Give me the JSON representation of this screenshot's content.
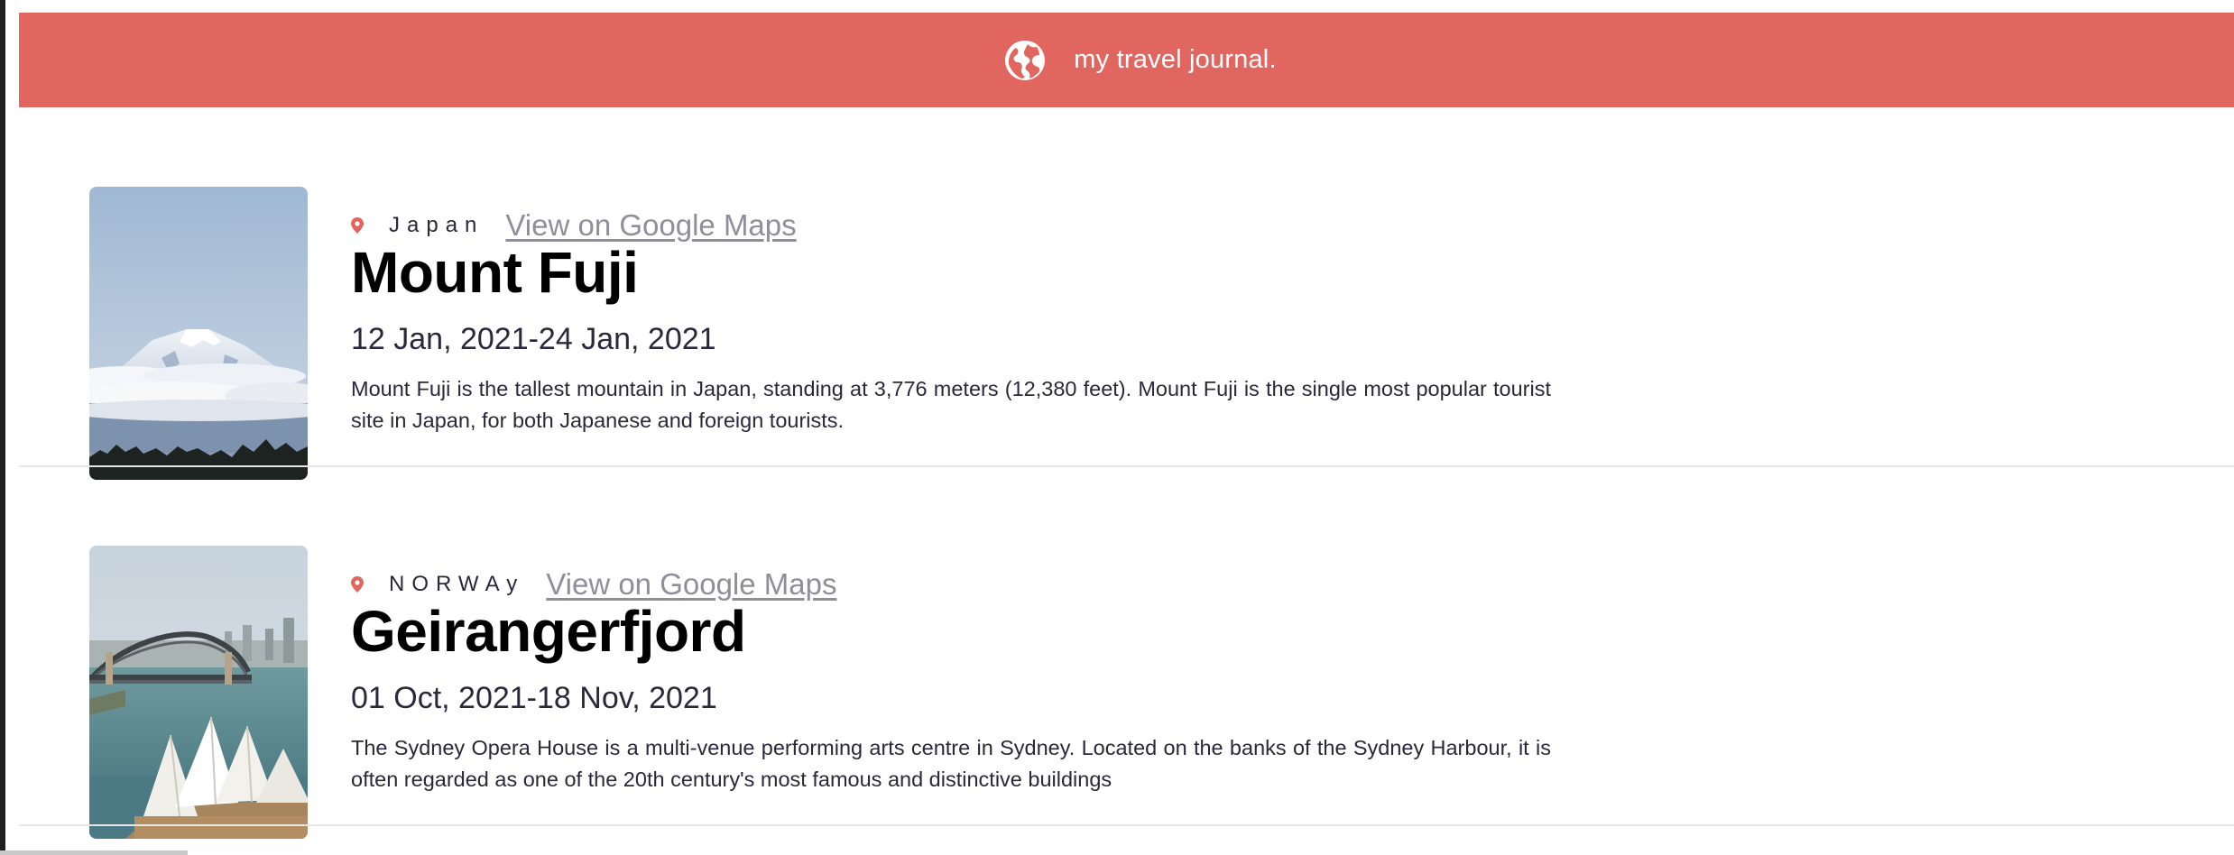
{
  "header": {
    "title": "my travel journal.",
    "icon": "globe-icon",
    "background_color": "#e26660"
  },
  "entries": [
    {
      "image": "mount-fuji-photo",
      "location_icon": "map-pin-icon",
      "country": "Japan",
      "maps_link_label": "View on Google Maps",
      "title": "Mount Fuji",
      "dates": "12 Jan, 2021-24 Jan, 2021",
      "description": "Mount Fuji is the tallest mountain in Japan, standing at 3,776 meters (12,380 feet). Mount Fuji is the single most popular tourist site in Japan, for both Japanese and foreign tourists."
    },
    {
      "image": "sydney-opera-house-photo",
      "location_icon": "map-pin-icon",
      "country": "NORWAy",
      "maps_link_label": "View on Google Maps",
      "title": "Geirangerfjord",
      "dates": "01 Oct, 2021-18 Nov, 2021",
      "description": "The Sydney Opera House is a multi-venue performing arts centre in Sydney. Located on the banks of the Sydney Harbour, it is often regarded as one of the 20th century's most famous and distinctive buildings"
    }
  ],
  "colors": {
    "accent": "#e26660",
    "link": "#918e9b",
    "text": "#2b283a"
  }
}
